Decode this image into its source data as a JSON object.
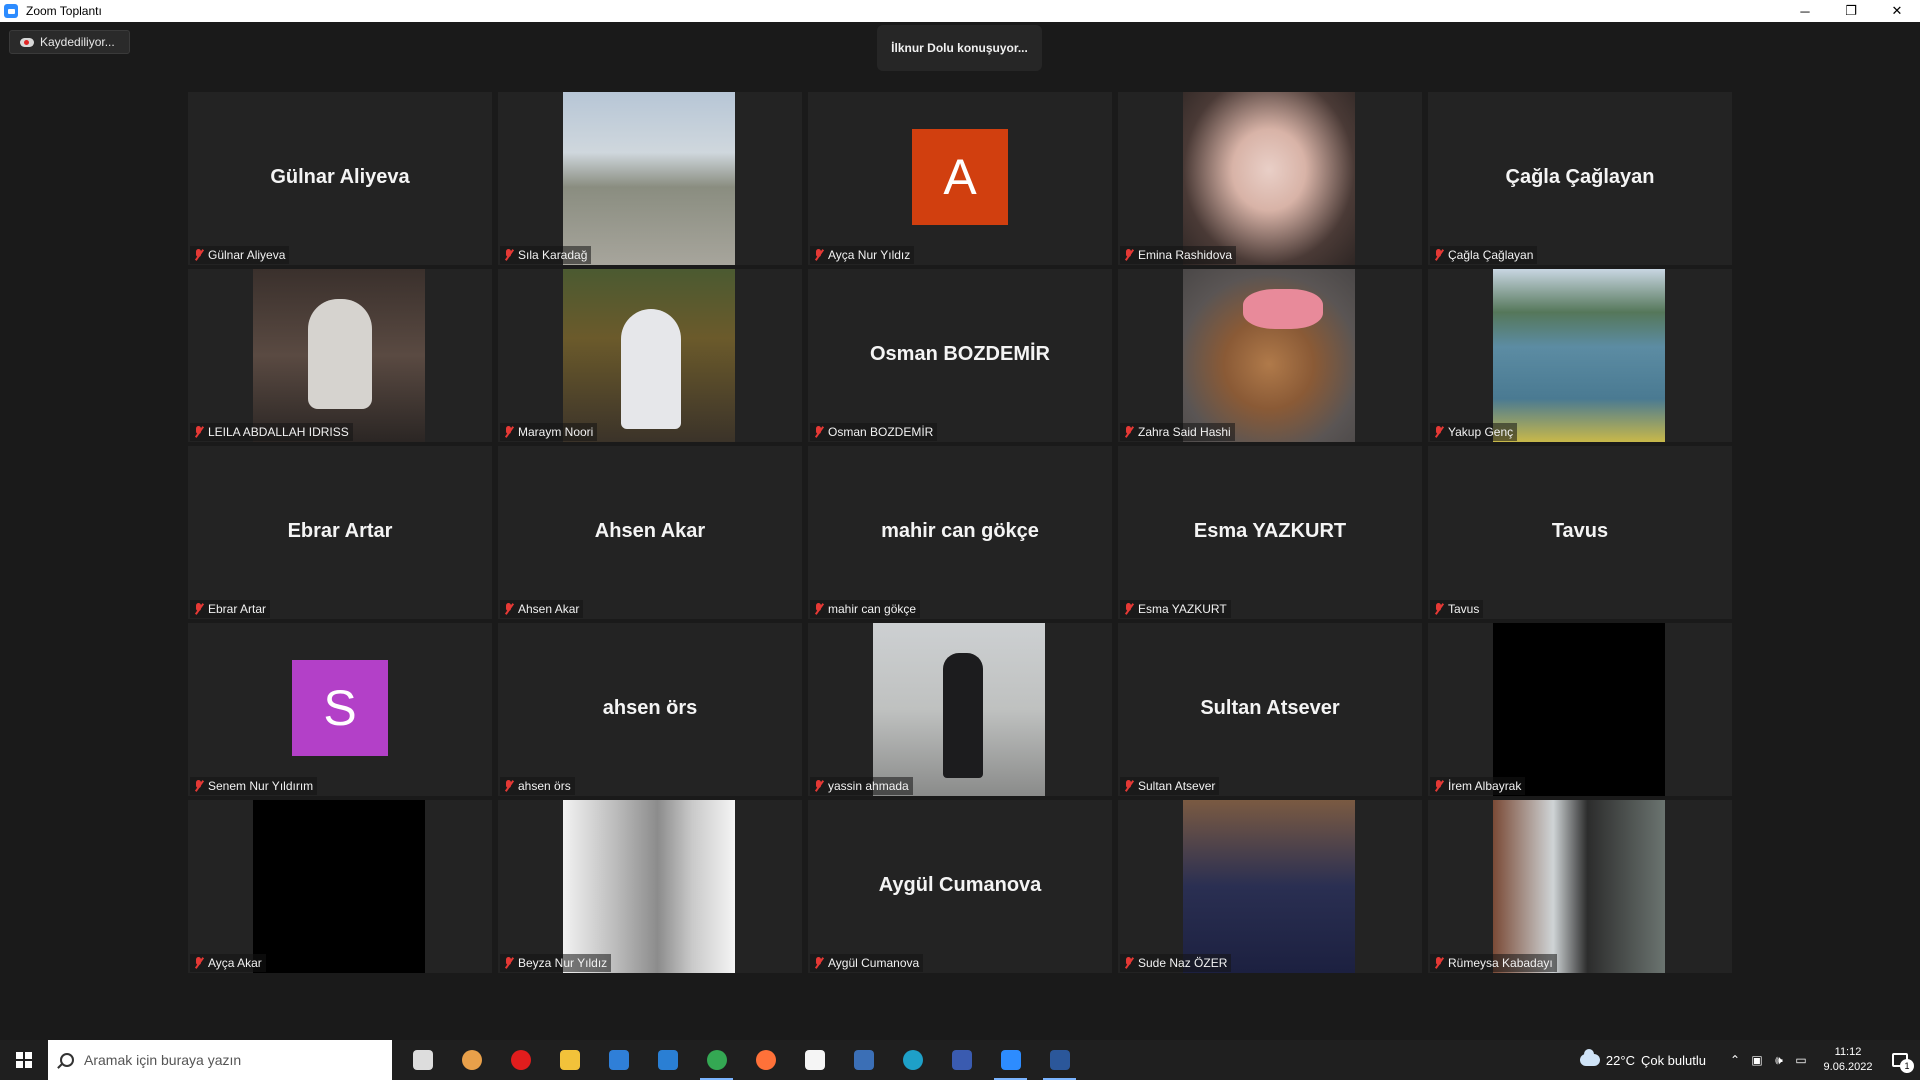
{
  "window": {
    "title": "Zoom Toplantı",
    "minimize_glyph": "─",
    "restore_glyph": "❐",
    "close_glyph": "✕"
  },
  "meeting": {
    "recording_label": "Kaydediliyor...",
    "speaking_label": "İlknur Dolu konuşuyor...",
    "participants": [
      {
        "name": "Gülnar Aliyeva",
        "display": "name"
      },
      {
        "name": "Sıla Karadağ",
        "display": "video"
      },
      {
        "name": "Ayça Nur Yıldız",
        "display": "avatar",
        "initial": "A",
        "avatar_color": "#d13f0f"
      },
      {
        "name": "Emina Rashidova",
        "display": "video"
      },
      {
        "name": "Çağla Çağlayan",
        "display": "name"
      },
      {
        "name": "LEILA ABDALLAH IDRISS",
        "display": "video"
      },
      {
        "name": "Maraym Noori",
        "display": "video"
      },
      {
        "name": "Osman BOZDEMİR",
        "display": "name"
      },
      {
        "name": "Zahra Said Hashi",
        "display": "video"
      },
      {
        "name": "Yakup Genç",
        "display": "video"
      },
      {
        "name": "Ebrar Artar",
        "display": "name"
      },
      {
        "name": "Ahsen Akar",
        "display": "name"
      },
      {
        "name": "mahir can gökçe",
        "display": "name"
      },
      {
        "name": "Esma YAZKURT",
        "display": "name"
      },
      {
        "name": "Tavus",
        "display": "name"
      },
      {
        "name": "Senem Nur Yıldırım",
        "display": "avatar",
        "initial": "S",
        "avatar_color": "#b340c8"
      },
      {
        "name": "ahsen örs",
        "display": "name"
      },
      {
        "name": "yassin ahmada",
        "display": "video"
      },
      {
        "name": "Sultan Atsever",
        "display": "name"
      },
      {
        "name": "İrem Albayrak",
        "display": "video"
      },
      {
        "name": "Ayça Akar",
        "display": "video"
      },
      {
        "name": "Beyza Nur Yıldız",
        "display": "video"
      },
      {
        "name": "Aygül Cumanova",
        "display": "name"
      },
      {
        "name": "Sude Naz ÖZER",
        "display": "video"
      },
      {
        "name": "Rümeysa Kabadayı",
        "display": "video"
      }
    ]
  },
  "taskbar": {
    "search_placeholder": "Aramak için buraya yazın",
    "pinned": [
      {
        "name": "task-view-icon",
        "color": "#dddddd"
      },
      {
        "name": "firefox-dev-icon",
        "color": "#e8a04a"
      },
      {
        "name": "screen-recorder-icon",
        "color": "#e11d1d"
      },
      {
        "name": "file-explorer-icon",
        "color": "#f2c23a"
      },
      {
        "name": "microsoft-store-icon",
        "color": "#2f7fd8"
      },
      {
        "name": "mail-icon",
        "color": "#2a7fd4"
      },
      {
        "name": "chrome-icon",
        "color": "#34a853"
      },
      {
        "name": "firefox-icon",
        "color": "#ff7139"
      },
      {
        "name": "document-icon",
        "color": "#f5f5f5"
      },
      {
        "name": "news-icon",
        "color": "#3b6fb6"
      },
      {
        "name": "edge-icon",
        "color": "#1ea0c8"
      },
      {
        "name": "obys-icon",
        "color": "#3a5bb0"
      },
      {
        "name": "zoom-icon",
        "color": "#2d8cff"
      },
      {
        "name": "word-icon",
        "color": "#2b579a"
      }
    ],
    "active_apps": [
      "zoom-icon",
      "word-icon",
      "chrome-icon"
    ],
    "weather_temp": "22°C",
    "weather_text": "Çok bulutlu",
    "time": "11:12",
    "date": "9.06.2022",
    "notification_count": "1"
  }
}
